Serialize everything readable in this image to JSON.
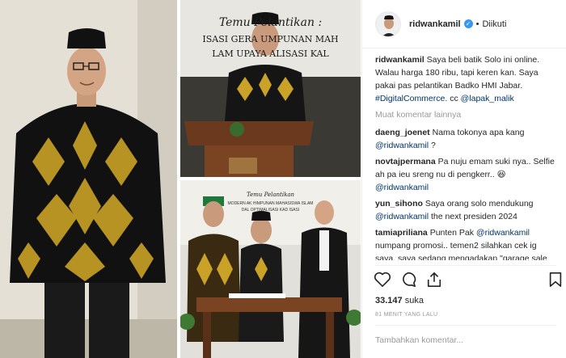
{
  "post": {
    "username": "ridwankamil",
    "verified_mark": "✓",
    "dot": "•",
    "follow_status": "Diikuti",
    "caption_user": "ridwankamil",
    "caption_text": "Saya beli batik Solo ini online. Walau harga 180 ribu, tapi keren kan. Saya pakai pas pelantikan Badko HMI Jabar.",
    "caption_hashtag": "#DigitalCommerce",
    "caption_cc": ". cc",
    "caption_mention": "@lapak_malik"
  },
  "load_more": "Muat komentar lainnya",
  "comments": [
    {
      "user": "daeng_joenet",
      "text": "Nama tokonya apa kang",
      "mention": "@ridwankamil",
      "after": " ?"
    },
    {
      "user": "novtajpermana",
      "text": "Pa nuju emam suki nya.. Selfie ah pa ieu sreng nu di pengkerr..",
      "emoji": "😆",
      "mention": "@ridwankamil",
      "after": ""
    },
    {
      "user": "yun_sihono",
      "text": "Saya orang solo mendukung",
      "mention": "@ridwankamil",
      "after": " the next presiden 2024"
    },
    {
      "user": "tamiapriliana",
      "text": "Punten Pak",
      "mention": "@ridwankamil",
      "after": " numpang promosi.. temen2 silahkan cek ig saya, saya sedang mengadakan \"garage sale for hope\" pakaian layak pakai yang"
    }
  ],
  "likes": {
    "count": "33.147",
    "label": "suka"
  },
  "timestamp": "81 MENIT YANG LALU",
  "add_comment_placeholder": "Tambahkan komentar...",
  "images": {
    "top_right_banner_line1": "Temu Pelantikan :",
    "top_right_banner_line2": "ISASI GERA  UMPUNAN MAH",
    "top_right_banner_line3": "LAM UPAYA  ALISASI KAL",
    "bottom_right_banner_line1": "Temu Pelantikan",
    "bottom_right_banner_line2": "MODERN   AK HIMPUNAN MAHASISWA ISLAM",
    "bottom_right_banner_line3": "DAL      OPTIMALISASI KAD ISASI"
  }
}
